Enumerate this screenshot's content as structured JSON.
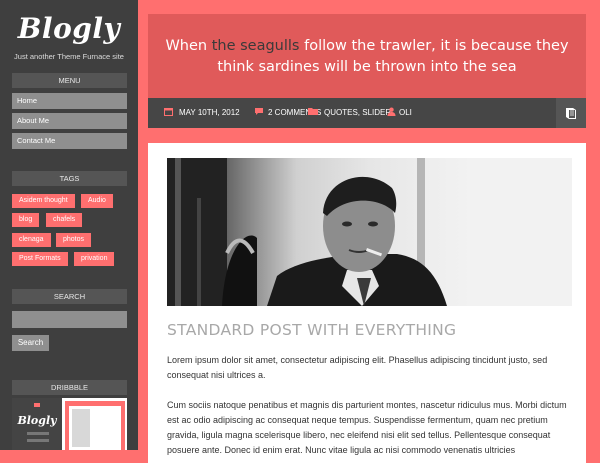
{
  "site": {
    "logo": "Blogly",
    "tagline": "Just another Theme Furnace site"
  },
  "menu": {
    "title": "MENU",
    "items": [
      "Home",
      "About Me",
      "Contact Me"
    ]
  },
  "tags": {
    "title": "TAGS",
    "items": [
      "Asidem thought",
      "Audio",
      "blog",
      "chafels",
      "clenaga",
      "photos",
      "Post Formats",
      "privation"
    ]
  },
  "search": {
    "title": "SEARCH",
    "placeholder": "",
    "button": "Search"
  },
  "dribbble": {
    "title": "DRIBBBLE"
  },
  "quote": {
    "before": "When ",
    "highlight": "the seagulls",
    "after": " follow the trawler, it is because they think sardines will be thrown into the sea"
  },
  "meta": {
    "date": "MAY 10TH, 2012",
    "comments": "2 COMMENTS",
    "categories": "QUOTES, SLIDER",
    "author": "OLI",
    "icons": [
      "calendar-icon",
      "comment-icon",
      "folder-icon",
      "user-icon",
      "book-icon"
    ]
  },
  "post": {
    "title": "STANDARD POST WITH EVERYTHING",
    "paragraph1": "Lorem ipsum dolor sit amet, consectetur adipiscing elit. Phasellus adipiscing tincidunt justo, sed consequat nisi ultrices a.",
    "paragraph2": "Cum sociis natoque penatibus et magnis dis parturient montes, nascetur ridiculus mus. Morbi dictum est ac odio adipiscing ac consequat neque tempus. Suspendisse fermentum, quam nec pretium gravida, ligula magna scelerisque libero, nec eleifend nisi elit sed tellus. Pellentesque consequat posuere ante. Donec id enim erat. Nunc vitae ligula ac nisi commodo venenatis ultricies"
  },
  "colors": {
    "accent": "#ff6f6f",
    "quote_bg": "#e05a5a",
    "sidebar_bg": "#3f3f3f",
    "meta_bg": "#464646"
  }
}
